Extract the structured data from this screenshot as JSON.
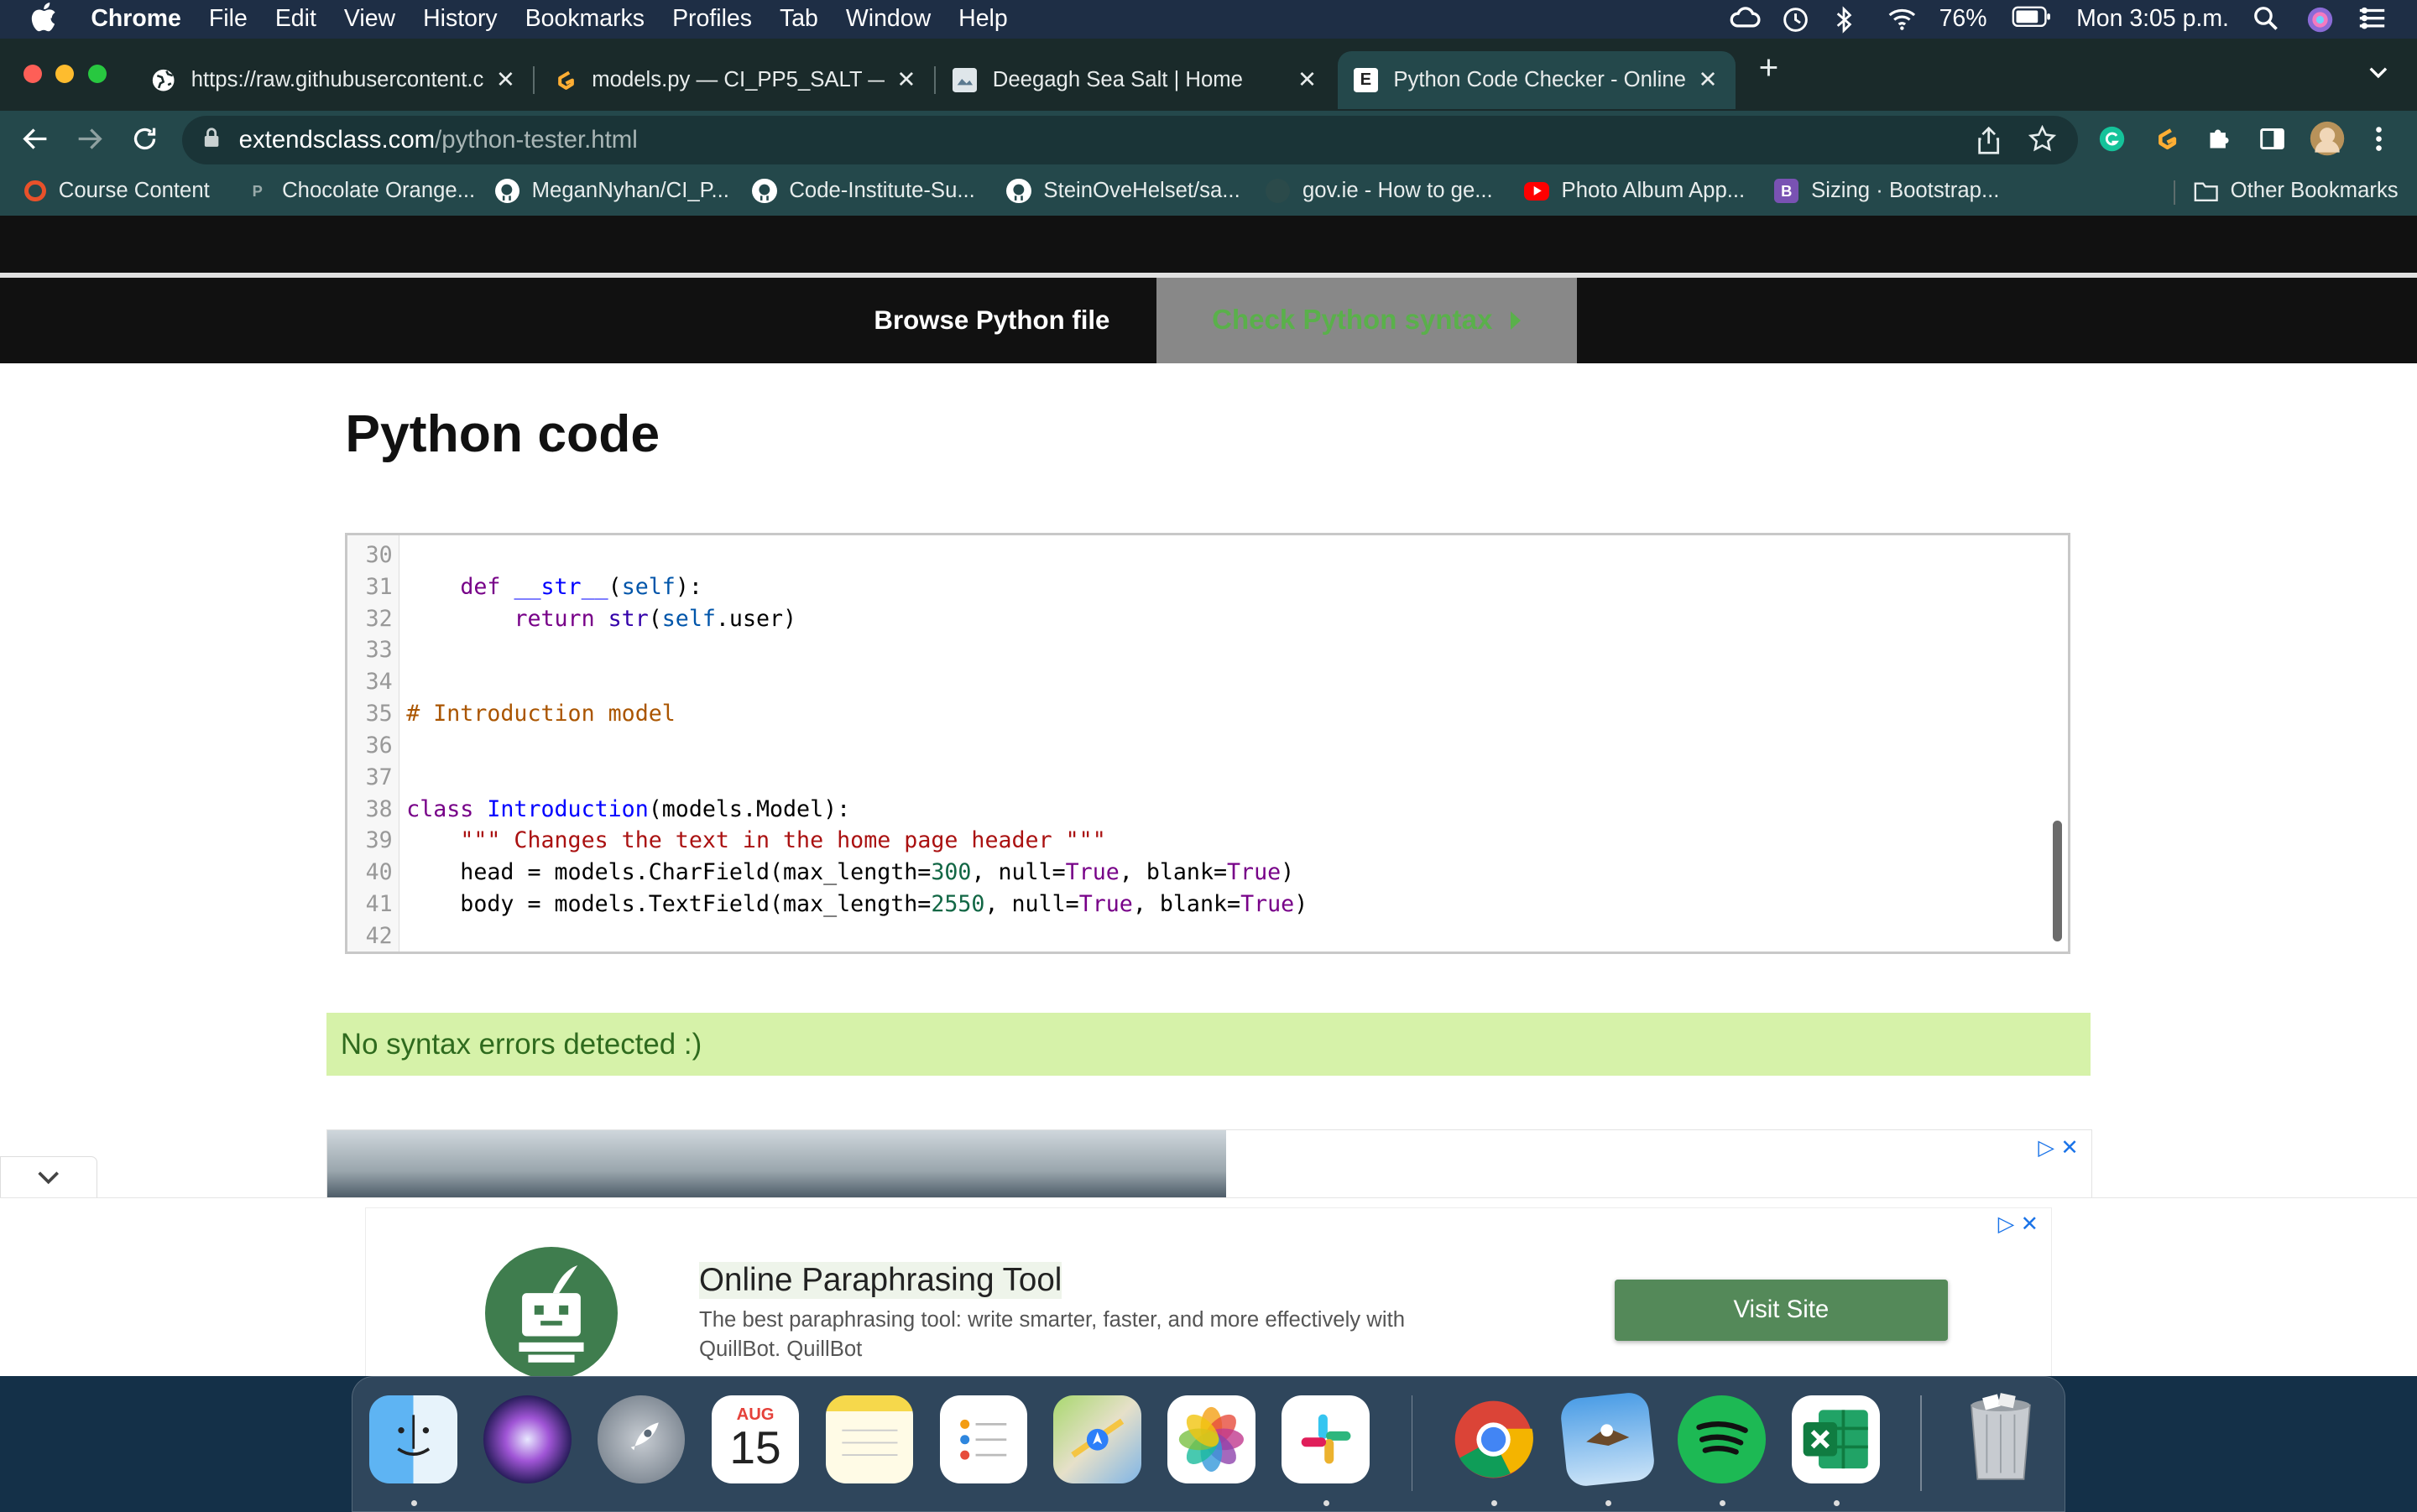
{
  "menubar": {
    "apple": "",
    "items": [
      "Chrome",
      "File",
      "Edit",
      "View",
      "History",
      "Bookmarks",
      "Profiles",
      "Tab",
      "Window",
      "Help"
    ],
    "battery": "76%",
    "clock": "Mon 3:05 p.m."
  },
  "tabs": [
    {
      "title": "https://raw.githubusercontent.c",
      "icon": "globe-icon"
    },
    {
      "title": "models.py — CI_PP5_SALT — (",
      "icon": "gitpod-icon"
    },
    {
      "title": "Deegagh Sea Salt | Home",
      "icon": "page-icon"
    },
    {
      "title": "Python Code Checker - Online",
      "icon": "extendsclass-icon",
      "favicon_letter": "E"
    }
  ],
  "address": {
    "host": "extendsclass.com",
    "path": "/python-tester.html"
  },
  "bookmarks": [
    {
      "label": "Course Content",
      "icon": "circle-icon",
      "color": "#e8512a"
    },
    {
      "label": "Chocolate Orange...",
      "icon": "p-icon",
      "color": "#9aa"
    },
    {
      "label": "MeganNyhan/CI_P...",
      "icon": "github-icon",
      "color": "#fff"
    },
    {
      "label": "Code-Institute-Su...",
      "icon": "github-icon",
      "color": "#fff"
    },
    {
      "label": "SteinOveHelset/sa...",
      "icon": "github-icon",
      "color": "#fff"
    },
    {
      "label": "gov.ie - How to ge...",
      "icon": "harp-icon",
      "color": "#2b4a4a"
    },
    {
      "label": "Photo Album App...",
      "icon": "youtube-icon",
      "color": "#f00"
    },
    {
      "label": "Sizing · Bootstrap...",
      "icon": "bootstrap-icon",
      "color": "#7952b3",
      "letter": "B"
    },
    {
      "label": "Other Bookmarks",
      "icon": "folder-icon",
      "color": "#ccc"
    }
  ],
  "page": {
    "browse_label": "Browse Python file",
    "check_label": "Check Python syntax",
    "title": "Python code",
    "result": "No syntax errors detected :)"
  },
  "code_lines": [
    {
      "n": "30",
      "text": ""
    },
    {
      "n": "31",
      "text": "    def __str__(self):"
    },
    {
      "n": "32",
      "text": "        return str(self.user)"
    },
    {
      "n": "33",
      "text": ""
    },
    {
      "n": "34",
      "text": ""
    },
    {
      "n": "35",
      "text": "# Introduction model"
    },
    {
      "n": "36",
      "text": ""
    },
    {
      "n": "37",
      "text": ""
    },
    {
      "n": "38",
      "text": "class Introduction(models.Model):"
    },
    {
      "n": "39",
      "text": "    \"\"\" Changes the text in the home page header \"\"\""
    },
    {
      "n": "40",
      "text": "    head = models.CharField(max_length=300, null=True, blank=True)"
    },
    {
      "n": "41",
      "text": "    body = models.TextField(max_length=2550, null=True, blank=True)"
    },
    {
      "n": "42",
      "text": ""
    }
  ],
  "ad": {
    "title": "Online Paraphrasing Tool",
    "description": "The best paraphrasing tool: write smarter, faster, and more effectively with QuillBot. QuillBot",
    "cta": "Visit Site"
  },
  "dock": {
    "calendar_month": "AUG",
    "calendar_day": "15",
    "apps": [
      "Finder",
      "Siri",
      "Launchpad",
      "Calendar",
      "Notes",
      "Reminders",
      "Maps",
      "Photos",
      "Slack",
      "Chrome",
      "Mail",
      "Spotify",
      "Excel",
      "Trash"
    ]
  }
}
